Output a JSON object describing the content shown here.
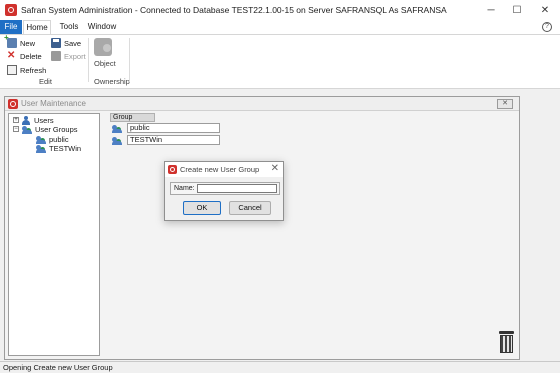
{
  "window": {
    "title": "Safran System Administration - Connected to Database TEST22.1.00-15 on Server SAFRANSQL As SAFRANSA",
    "minimize": "─",
    "maximize": "☐",
    "close": "✕"
  },
  "menu": {
    "items": [
      "File",
      "Home",
      "Tools",
      "Window"
    ],
    "help": "?"
  },
  "ribbon": {
    "new_label": "New",
    "delete_label": "Delete",
    "refresh_label": "Refresh",
    "save_label": "Save",
    "export_label": "Export",
    "object_label": "Object",
    "group_edit": "Edit",
    "group_ownership": "Ownership"
  },
  "child_window": {
    "title": "User Maintenance",
    "close": "✕"
  },
  "tree": {
    "users_label": "Users",
    "user_groups_label": "User Groups",
    "children": [
      "public",
      "TESTWin"
    ],
    "expand_symbol": "+",
    "collapse_symbol": "−"
  },
  "group_list": {
    "header": "Group",
    "rows": [
      "public",
      "TESTWin"
    ]
  },
  "dialog": {
    "title": "Create new User Group",
    "close": "✕",
    "name_label": "Name:",
    "name_value": "",
    "ok_label": "OK",
    "cancel_label": "Cancel"
  },
  "status": {
    "text": "Opening Create new User Group"
  },
  "colors": {
    "accent": "#1f6fc5",
    "brand": "#d0312d"
  },
  "icons": {
    "app": "safran-logo-icon",
    "new": "new-icon",
    "delete": "delete-icon",
    "refresh": "refresh-icon",
    "save": "save-icon",
    "export": "export-icon",
    "object": "object-owner-icon",
    "user": "user-icon",
    "group": "group-icon",
    "trash": "trash-icon"
  }
}
